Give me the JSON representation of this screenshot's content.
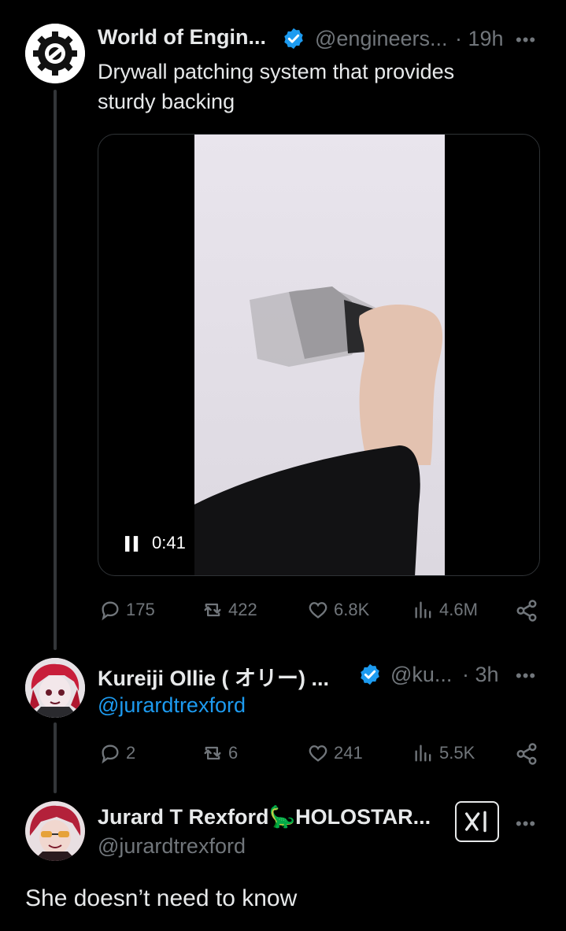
{
  "tweet1": {
    "author_name": "World of Engin...",
    "handle": "@engineers...",
    "time": "· 19h",
    "more": "•••",
    "text_line1": "Drywall patching system that provides",
    "text_line2": "sturdy backing",
    "video": {
      "time": "0:41",
      "state": "playing"
    },
    "replies": "175",
    "reposts": "422",
    "likes": "6.8K",
    "views": "4.6M"
  },
  "tweet2": {
    "author_name": "Kureiji Ollie ( オリー) ...",
    "handle": "@ku...",
    "time": "· 3h",
    "more": "•••",
    "mention": "@jurardtrexford",
    "replies": "2",
    "reposts": "6",
    "likes": "241",
    "views": "5.5K"
  },
  "tweet3": {
    "author_name": "Jurard T Rexford",
    "name_emoji": "🦕",
    "name_suffix": "HOLOSTAR...",
    "handle": "@jurardtrexford",
    "more": "•••",
    "text": "She doesn’t need to know"
  },
  "colors": {
    "background": "#000000",
    "text": "#e7e9ea",
    "secondary": "#71767b",
    "link": "#1d9bf0",
    "verified": "#1d9bf0"
  }
}
